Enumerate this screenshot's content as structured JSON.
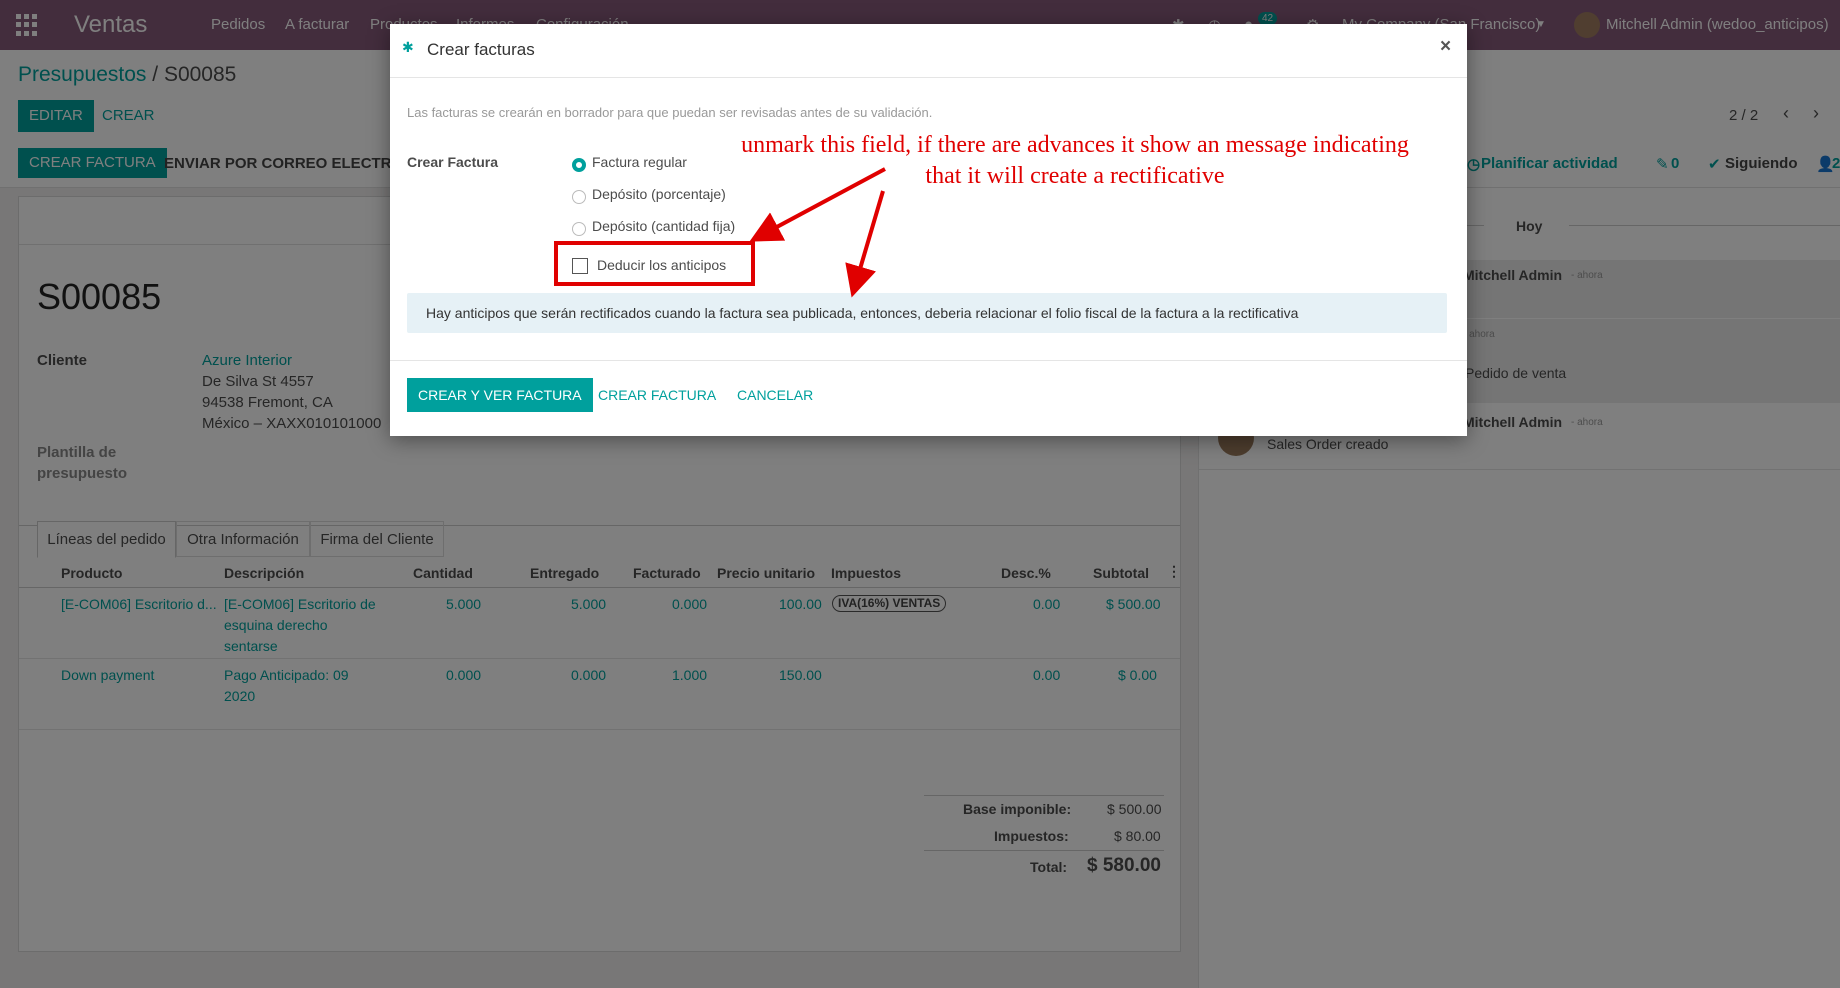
{
  "topbar": {
    "app_name": "Ventas",
    "nav": [
      "Pedidos",
      "A facturar",
      "Productos",
      "Informes",
      "Configuración"
    ],
    "messages_count": "42",
    "company": "My Company (San Francisco)",
    "user": "Mitchell Admin (wedoo_anticipos)"
  },
  "breadcrumb": {
    "parent": "Presupuestos",
    "sep": " / ",
    "current": "S00085"
  },
  "control": {
    "edit": "EDITAR",
    "create": "CREAR",
    "pager": "2 / 2"
  },
  "statusbar": {
    "create_invoice": "CREAR FACTURA",
    "send_email": "ENVIAR POR CORREO ELECTRÓNICO",
    "plan_activity": "Planificar actividad",
    "attachments": "0",
    "following": "Siguiendo",
    "followers": "2"
  },
  "form": {
    "name": "S00085",
    "customer_label": "Cliente",
    "customer_name": "Azure Interior",
    "address1": "De Silva St 4557",
    "address2": "94538 Fremont, CA",
    "address3": "México – XAXX010101000",
    "template_label": "Plantilla de presupuesto",
    "tabs": [
      "Líneas del pedido",
      "Otra Información",
      "Firma del Cliente"
    ],
    "columns": [
      "Producto",
      "Descripción",
      "Cantidad",
      "Entregado",
      "Facturado",
      "Precio unitario",
      "Impuestos",
      "Desc.%",
      "Subtotal"
    ],
    "rows": [
      {
        "product": "[E-COM06] Escritorio d...",
        "desc1": "[E-COM06] Escritorio de",
        "desc2": "esquina derecho",
        "desc3": "sentarse",
        "qty": "5.000",
        "delivered": "5.000",
        "invoiced": "0.000",
        "price": "100.00",
        "tax": "IVA(16%) VENTAS",
        "discount": "0.00",
        "subtotal": "$ 500.00"
      },
      {
        "product": "Down payment",
        "desc1": "Pago Anticipado: 09",
        "desc2": "2020",
        "qty": "0.000",
        "delivered": "0.000",
        "invoiced": "1.000",
        "price": "150.00",
        "tax": "",
        "discount": "0.00",
        "subtotal": "$ 0.00"
      }
    ],
    "totals": {
      "base_label": "Base imponible:",
      "base": "$ 500.00",
      "tax_label": "Impuestos:",
      "tax": "$ 80.00",
      "total_label": "Total:",
      "total": "$ 580.00"
    }
  },
  "chatter": {
    "date": "Hoy",
    "author": "Mitchell Admin",
    "time": "- ahora",
    "msg_order": "Pedido de venta",
    "msg_created": "Sales Order creado"
  },
  "modal": {
    "title": "Crear facturas",
    "info": "Las facturas se crearán en borrador para que puedan ser revisadas antes de su validación.",
    "field_label": "Crear Factura",
    "options": [
      "Factura regular",
      "Depósito (porcentaje)",
      "Depósito (cantidad fija)"
    ],
    "selected_option": 0,
    "deduct_label": "Deducir los anticipos",
    "deduct_checked": false,
    "alert": "Hay anticipos que serán rectificados cuando la factura sea publicada, entonces, deberia relacionar el folio fiscal de la factura a la rectificativa",
    "btn_create_view": "CREAR Y VER FACTURA",
    "btn_create": "CREAR FACTURA",
    "btn_cancel": "CANCELAR"
  },
  "annotation": {
    "line1": "unmark this field, if there are advances it show an message indicating",
    "line2": "that it will create a rectificative"
  },
  "colors": {
    "brand": "#875a7b",
    "accent": "#00a09d",
    "annotation": "#e00000"
  }
}
